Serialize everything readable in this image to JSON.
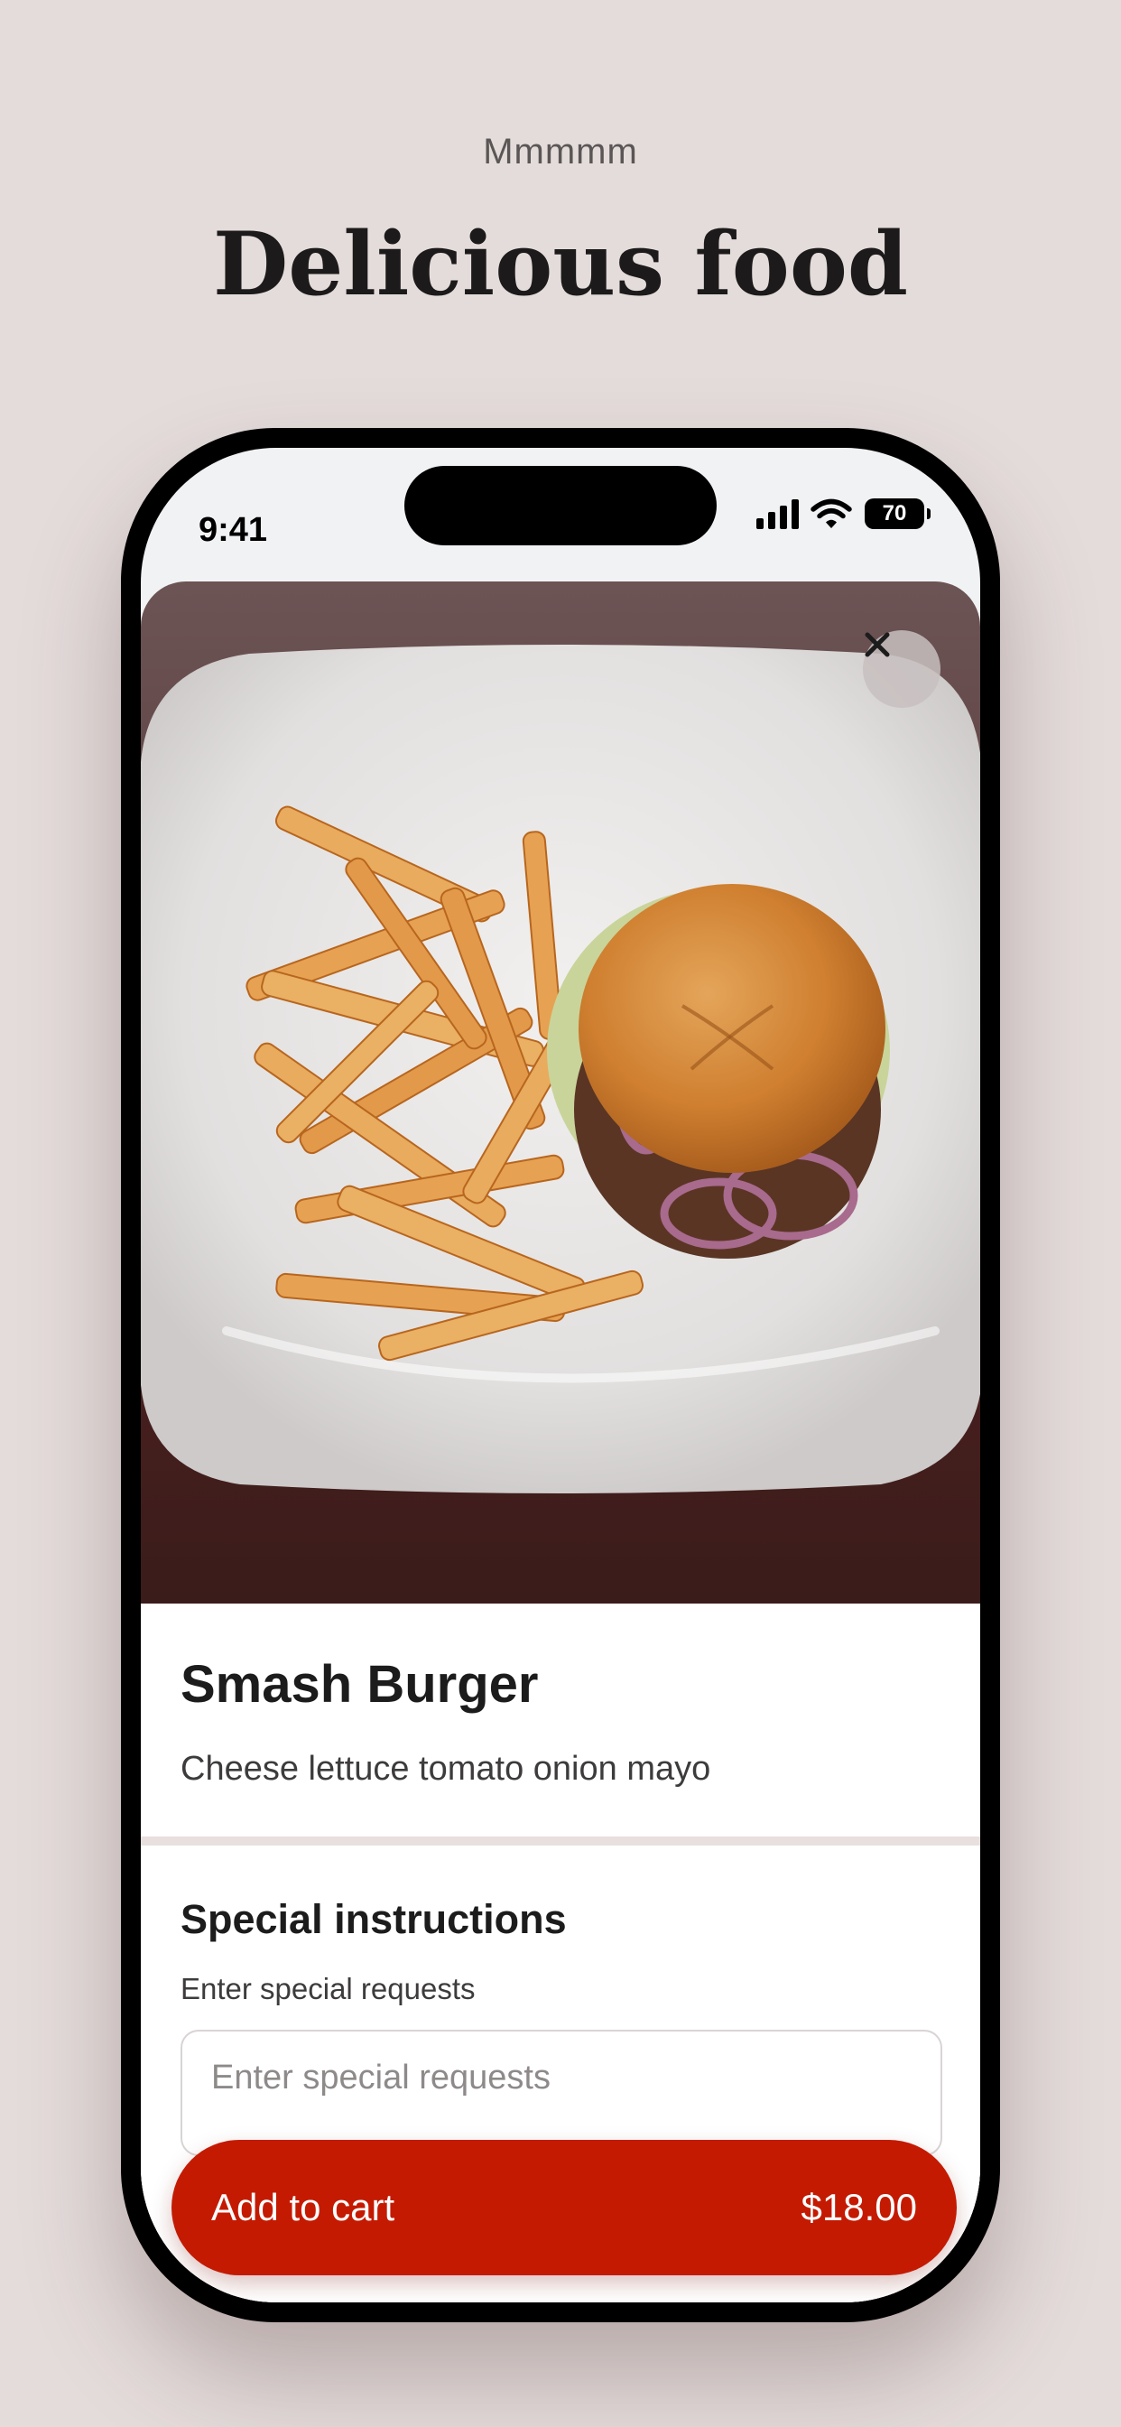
{
  "promo": {
    "eyebrow": "Mmmmm",
    "headline": "Delicious food"
  },
  "status_bar": {
    "time": "9:41",
    "battery": "70"
  },
  "item": {
    "name": "Smash Burger",
    "description": "Cheese lettuce tomato onion mayo",
    "image_icon": "burger-and-fries-photo"
  },
  "instructions": {
    "title": "Special instructions",
    "label": "Enter special requests",
    "placeholder": "Enter special requests",
    "value": ""
  },
  "cart": {
    "label": "Add to cart",
    "price": "$18.00"
  },
  "colors": {
    "background": "#e4dcdb",
    "accent": "#c41a02",
    "text": "#1d1c1d"
  }
}
